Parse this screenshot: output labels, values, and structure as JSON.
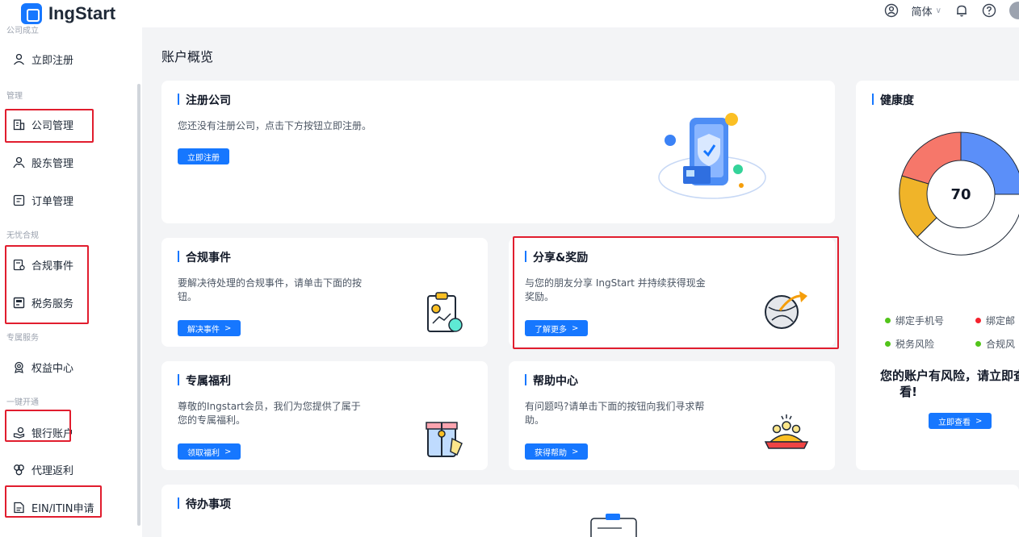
{
  "header": {
    "app_name": "IngStart",
    "language": "简体",
    "icons": [
      "user-shield-icon",
      "bell-icon",
      "help-icon"
    ]
  },
  "sidebar": {
    "sections": {
      "company_setup": "公司成立",
      "management": "管理",
      "compliance": "无忧合规",
      "exclusive": "专属服务",
      "one_click": "一键开通"
    },
    "items": {
      "register": "立即注册",
      "company_mgmt": "公司管理",
      "shareholder_mgmt": "股东管理",
      "order_mgmt": "订单管理",
      "compliance_events": "合规事件",
      "tax_services": "税务服务",
      "benefits_center": "权益中心",
      "bank_account": "银行账户",
      "agent_rebate": "代理返利",
      "ein_itin": "EIN/ITIN申请"
    }
  },
  "main": {
    "page_title": "账户概览",
    "register_card": {
      "title": "注册公司",
      "desc": "您还没有注册公司，点击下方按钮立即注册。",
      "button": "立即注册"
    },
    "compliance_card": {
      "title": "合规事件",
      "desc": "要解决待处理的合规事件，请单击下面的按钮。",
      "button": "解决事件"
    },
    "share_card": {
      "title": "分享&奖励",
      "desc": "与您的朋友分享 IngStart 并持续获得现金奖励。",
      "button": "了解更多"
    },
    "welfare_card": {
      "title": "专属福利",
      "desc": "尊敬的Ingstart会员，我们为您提供了属于您的专属福利。",
      "button": "领取福利"
    },
    "help_card": {
      "title": "帮助中心",
      "desc": "有问题吗?请单击下面的按钮向我们寻求帮助。",
      "button": "获得帮助"
    },
    "todo_card": {
      "title": "待办事项"
    }
  },
  "health": {
    "title": "健康度",
    "score": "70",
    "legend": [
      {
        "label": "绑定手机号",
        "status": "ok"
      },
      {
        "label": "绑定邮",
        "status": "bad"
      },
      {
        "label": "税务风险",
        "status": "ok"
      },
      {
        "label": "合规风",
        "status": "ok"
      }
    ],
    "risk_message_1": "您的账户有风险，请立即查",
    "risk_message_2": "看!",
    "button": "立即查看",
    "colors": {
      "blue": "#5b8ff9",
      "red": "#f6776a",
      "yellow": "#f0b429",
      "ok": "#52c41a",
      "bad": "#f5222d"
    }
  }
}
